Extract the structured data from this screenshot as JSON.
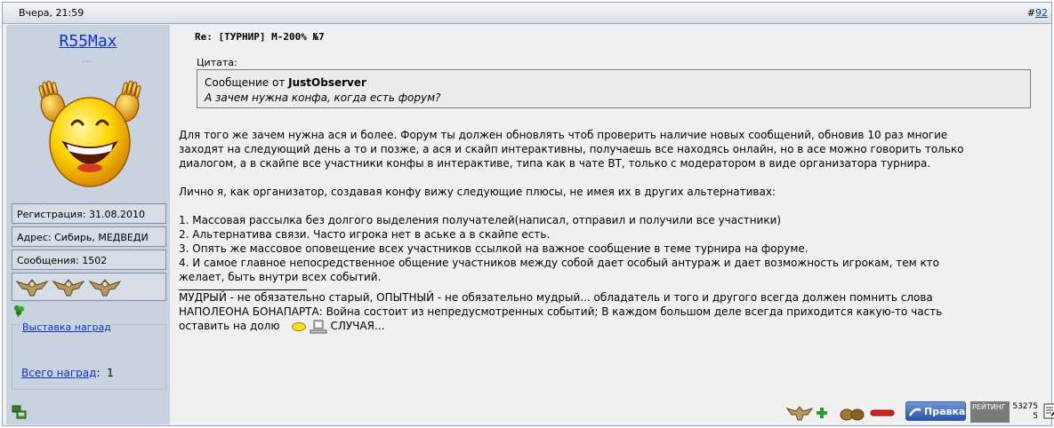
{
  "post": {
    "date": "Вчера, 21:59",
    "number_prefix": "#",
    "number": "92",
    "title": "Re: [ТУРНИР] М-200% №7"
  },
  "user": {
    "name": "R55Max",
    "title": "---",
    "registration": "Регистрация: 31.08.2010",
    "address": "Адрес: Сибирь, МЕДВЕДИ",
    "messages": "Сообщения: 1502",
    "awards_legend": "Выставка наград",
    "awards_total_label": "Всего наград",
    "awards_total_sep": ":",
    "awards_total_value": "1"
  },
  "quote": {
    "label": "Цитата:",
    "from_prefix": "Сообщение от",
    "author": "JustObserver",
    "text": "А зачем нужна конфа, когда есть форум?"
  },
  "body": {
    "p1_l1": "Для того же зачем нужна ася и более. Форум ты должен обновлять чтоб проверить наличие новых сообщений, обновив 10 раз многие",
    "p1_l2": "заходят на следующий день а то и позже, а ася и скайп интерактивны, получаешь все находясь онлайн, но в асе можно говорить только",
    "p1_l3": "диалогом, а в скайпе все участники конфы в интерактиве, типа как в чате ВТ, только с модератором в виде организатора турнира.",
    "p2": "Лично я, как организатор, создавая конфу вижу следующие плюсы, не имея их в других альтернативах:",
    "l1": "1. Массовая рассылка без долгого выделения получателей(написал, отправил и получили все участники)",
    "l2": "2. Альтернатива связи. Часто игрока нет в аське а в скайпе есть.",
    "l3": "3. Опять же массовое оповещение всех участников ссылкой на важное сообщение в теме турнира на форуме.",
    "l4a": "4. И самое главное непосредственное общение участников между собой дает особый антураж и дает возможность игрокам, тем кто",
    "l4b": "желает, быть внутри всех событий.",
    "sig1": "МУДРЫЙ - не обязательно старый, ОПЫТНЫЙ - не обязательно мудрый... обладатель и того и другого всегда должен помнить слова",
    "sig2": "НАПОЛЕОНА БОНАПАРТА: Война состоит из непредусмотренных событий; В каждом большом деле всегда приходится какую-то часть",
    "sig3a": "оставить на долю",
    "sig3b": "СЛУЧАЯ..."
  },
  "footer": {
    "edit_label": "Правка",
    "rating_label": "РЕЙТИНГ",
    "rating_value": "53275",
    "rating_sub": "5"
  },
  "colors": {
    "link": "#1030c8",
    "sidebar_bg": "#c9d3df",
    "content_bg": "#f0f0f0"
  },
  "icons": [
    "smiley-avatar-icon",
    "eagle-medal-icon",
    "clover-icon",
    "user-online-icon",
    "smiley-icon",
    "computer-icon",
    "plus-icon",
    "minus-icon",
    "edit-icon",
    "report-icon"
  ]
}
